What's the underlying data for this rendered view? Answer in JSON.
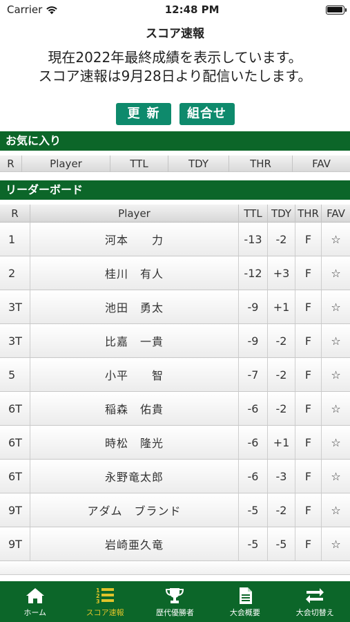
{
  "status": {
    "carrier": "Carrier",
    "time": "12:48 PM"
  },
  "nav": {
    "title": "スコア速報"
  },
  "notice": {
    "line1": "現在2022年最終成績を表示しています。",
    "line2": "スコア速報は9月28日より配信いたします。"
  },
  "buttons": {
    "update": "更新",
    "combo": "組合せ"
  },
  "favorites": {
    "header": "お気に入り",
    "columns": [
      "R",
      "Player",
      "TTL",
      "TDY",
      "THR",
      "FAV"
    ]
  },
  "leaderboard": {
    "header": "リーダーボード",
    "columns": [
      "R",
      "Player",
      "TTL",
      "TDY",
      "THR",
      "FAV"
    ],
    "rows": [
      {
        "rank": "1",
        "player": "河本　　力",
        "ttl": "-13",
        "tdy": "-2",
        "thr": "F",
        "fav": "☆"
      },
      {
        "rank": "2",
        "player": "桂川　有人",
        "ttl": "-12",
        "tdy": "+3",
        "thr": "F",
        "fav": "☆"
      },
      {
        "rank": "3T",
        "player": "池田　勇太",
        "ttl": "-9",
        "tdy": "+1",
        "thr": "F",
        "fav": "☆"
      },
      {
        "rank": "3T",
        "player": "比嘉　一貴",
        "ttl": "-9",
        "tdy": "-2",
        "thr": "F",
        "fav": "☆"
      },
      {
        "rank": "5",
        "player": "小平　　智",
        "ttl": "-7",
        "tdy": "-2",
        "thr": "F",
        "fav": "☆"
      },
      {
        "rank": "6T",
        "player": "稲森　佑貴",
        "ttl": "-6",
        "tdy": "-2",
        "thr": "F",
        "fav": "☆"
      },
      {
        "rank": "6T",
        "player": "時松　隆光",
        "ttl": "-6",
        "tdy": "+1",
        "thr": "F",
        "fav": "☆"
      },
      {
        "rank": "6T",
        "player": "永野竜太郎",
        "ttl": "-6",
        "tdy": "-3",
        "thr": "F",
        "fav": "☆"
      },
      {
        "rank": "9T",
        "player": "アダム　ブランド",
        "ttl": "-5",
        "tdy": "-2",
        "thr": "F",
        "fav": "☆"
      },
      {
        "rank": "9T",
        "player": "岩崎亜久竜",
        "ttl": "-5",
        "tdy": "-5",
        "thr": "F",
        "fav": "☆"
      }
    ]
  },
  "tabs": [
    {
      "label": "ホーム",
      "icon": "home-icon",
      "active": false
    },
    {
      "label": "スコア速報",
      "icon": "ranking-list-icon",
      "active": true
    },
    {
      "label": "歴代優勝者",
      "icon": "trophy-icon",
      "active": false
    },
    {
      "label": "大会概要",
      "icon": "document-icon",
      "active": false
    },
    {
      "label": "大会切替え",
      "icon": "swap-icon",
      "active": false
    }
  ],
  "colors": {
    "accent_green": "#0c6629",
    "button_green": "#0e8a6c",
    "active_tab": "#e0c32a"
  }
}
